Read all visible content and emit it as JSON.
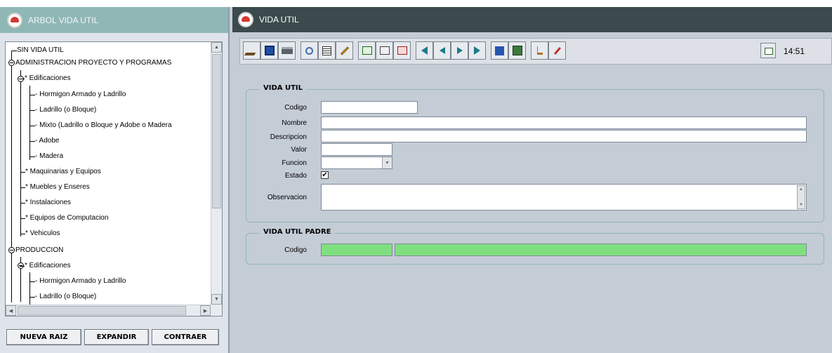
{
  "left_window": {
    "title": "ARBOL VIDA UTIL",
    "tree": [
      {
        "label": "SIN VIDA UTIL"
      },
      {
        "label": "ADMINISTRACION PROYECTO Y PROGRAMAS"
      },
      {
        "label": "* Edificaciones"
      },
      {
        "label": "- Hormigon Armado y Ladrillo"
      },
      {
        "label": "- Ladrillo (o Bloque)"
      },
      {
        "label": "- Mixto (Ladrillo o Bloque y Adobe o Madera"
      },
      {
        "label": "- Adobe"
      },
      {
        "label": "- Madera"
      },
      {
        "label": "* Maquinarias y Equipos"
      },
      {
        "label": "* Muebles y Enseres"
      },
      {
        "label": "* Instalaciones"
      },
      {
        "label": "* Equipos de Computacion"
      },
      {
        "label": "* Vehiculos"
      },
      {
        "label": "PRODUCCION"
      },
      {
        "label": "* Edificaciones"
      },
      {
        "label": "- Hormigon Armado y Ladrillo"
      },
      {
        "label": "- Ladrillo (o Bloque)"
      }
    ],
    "buttons": {
      "new_root": "NUEVA RAIZ",
      "expand": "EXPANDIR",
      "collapse": "CONTRAER"
    }
  },
  "right_window": {
    "title": "VIDA UTIL",
    "clock": "14:51",
    "section1": {
      "legend": "VIDA UTIL",
      "labels": {
        "codigo": "Codigo",
        "nombre": "Nombre",
        "descripcion": "Descripcion",
        "valor": "Valor",
        "funcion": "Funcion",
        "estado": "Estado",
        "observacion": "Observacion"
      },
      "values": {
        "codigo": "",
        "nombre": "",
        "descripcion": "",
        "valor": "",
        "funcion": "",
        "observacion": ""
      },
      "estado_checked": "✔"
    },
    "section2": {
      "legend": "VIDA UTIL PADRE",
      "labels": {
        "codigo": "Codigo"
      },
      "values": {
        "codigo": "",
        "nombre": ""
      }
    }
  },
  "icons": [
    "save-icon",
    "floppy-icon",
    "printer-icon",
    "search-icon",
    "list-icon",
    "edit-icon",
    "insert-record-icon",
    "duplicate-record-icon",
    "delete-record-icon",
    "first-record-icon",
    "prev-record-icon",
    "next-record-icon",
    "last-record-icon",
    "help-icon",
    "exit-icon",
    "anchor-icon",
    "brush-icon",
    "calendar-icon"
  ],
  "colors": {
    "field_green": "#80e080",
    "title_dark": "#3a4a4d",
    "title_teal": "#8fb7b6"
  }
}
